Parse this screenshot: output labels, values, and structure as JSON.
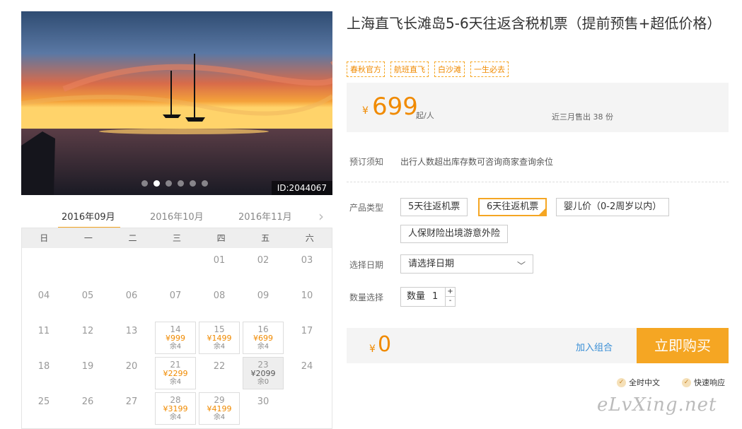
{
  "hero": {
    "id_label": "ID:2044067",
    "dots": 6,
    "active_dot": 1
  },
  "months": {
    "tabs": [
      "2016年09月",
      "2016年10月",
      "2016年11月"
    ],
    "active": 0
  },
  "calendar": {
    "weekdays": [
      "日",
      "一",
      "二",
      "三",
      "四",
      "五",
      "六"
    ],
    "weeks": [
      [
        null,
        null,
        null,
        null,
        {
          "d": "01"
        },
        {
          "d": "02"
        },
        {
          "d": "03"
        }
      ],
      [
        {
          "d": "04"
        },
        {
          "d": "05"
        },
        {
          "d": "06"
        },
        {
          "d": "07"
        },
        {
          "d": "08"
        },
        {
          "d": "09"
        },
        {
          "d": "10"
        }
      ],
      [
        {
          "d": "11"
        },
        {
          "d": "12"
        },
        {
          "d": "13"
        },
        {
          "d": "14",
          "price": "¥999",
          "rem": "余4"
        },
        {
          "d": "15",
          "price": "¥1499",
          "rem": "余4"
        },
        {
          "d": "16",
          "price": "¥699",
          "rem": "余4"
        },
        {
          "d": "17"
        }
      ],
      [
        {
          "d": "18"
        },
        {
          "d": "19"
        },
        {
          "d": "20"
        },
        {
          "d": "21",
          "price": "¥2299",
          "rem": "余4"
        },
        {
          "d": "22"
        },
        {
          "d": "23",
          "price": "¥2099",
          "rem": "余0",
          "soldout": true
        },
        {
          "d": "24"
        }
      ],
      [
        {
          "d": "25"
        },
        {
          "d": "26"
        },
        {
          "d": "27"
        },
        {
          "d": "28",
          "price": "¥3199",
          "rem": "余4"
        },
        {
          "d": "29",
          "price": "¥4199",
          "rem": "余4"
        },
        {
          "d": "30"
        },
        null
      ]
    ]
  },
  "product": {
    "title": "上海直飞长滩岛5-6天往返含税机票（提前预售+超低价格）",
    "tags": [
      "春秋官方",
      "航班直飞",
      "白沙滩",
      "一生必去"
    ],
    "currency": "¥",
    "price": "699",
    "price_unit": "起/人",
    "sold": "近三月售出 38 份"
  },
  "booking": {
    "notice_label": "预订须知",
    "notice_text": "出行人数超出库存数可咨询商家查询余位",
    "type_label": "产品类型",
    "types": [
      "5天往返机票",
      "6天往返机票",
      "婴儿价（0-2周岁以内）",
      "人保财险出境游意外险"
    ],
    "selected_type": 1,
    "date_label": "选择日期",
    "date_placeholder": "请选择日期",
    "qty_label": "数量选择",
    "qty_inner_label": "数量",
    "qty_value": "1",
    "qty_plus": "+",
    "qty_minus": "-"
  },
  "cart": {
    "currency": "¥",
    "total": "0",
    "add_combo": "加入组合",
    "buy": "立即购买"
  },
  "services": [
    "全时中文",
    "快速响应"
  ],
  "watermark": "eLvXing.net",
  "colors": {
    "accent": "#f5a623",
    "price": "#f08a00",
    "link": "#3a8fd6"
  }
}
